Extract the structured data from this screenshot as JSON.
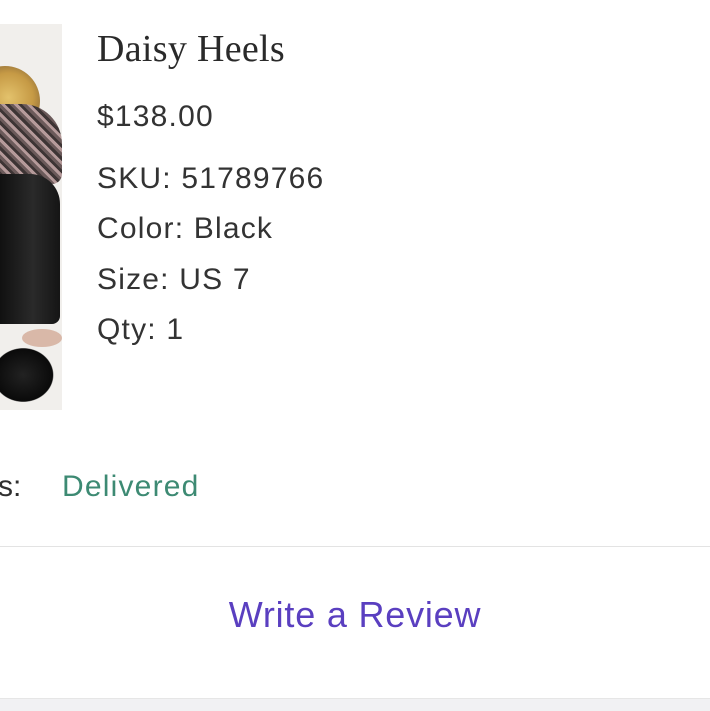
{
  "product": {
    "name": "Daisy Heels",
    "price": "$138.00",
    "sku": "SKU: 51789766",
    "color": "Color: Black",
    "size": "Size: US 7",
    "qty": "Qty: 1"
  },
  "status": {
    "label": "s:",
    "value": "Delivered",
    "value_color": "#3d8a73"
  },
  "actions": {
    "review_label": "Write a Review",
    "review_color": "#5a3fc0"
  }
}
